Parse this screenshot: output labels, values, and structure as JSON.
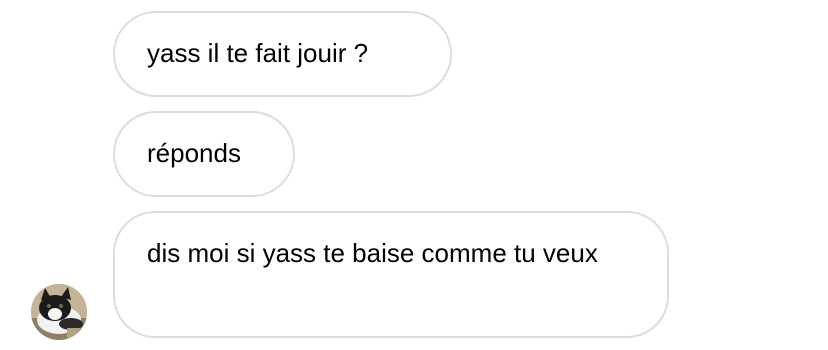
{
  "conversation": {
    "messages": [
      {
        "text": "yass il te fait jouir ?"
      },
      {
        "text": "réponds"
      },
      {
        "text": "dis moi si yass te baise comme tu veux"
      }
    ],
    "avatar": {
      "icon": "cat-photo-avatar",
      "description_colors": [
        "#b9a98c",
        "#1c1c1c",
        "#f2f2f2"
      ]
    },
    "colors": {
      "bubble_border": "#dcdcdc",
      "bubble_background": "#ffffff",
      "text": "#000000"
    }
  }
}
